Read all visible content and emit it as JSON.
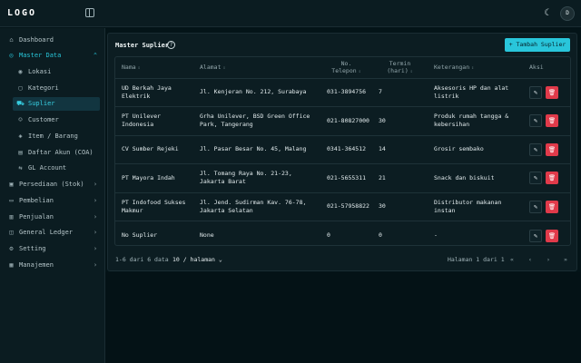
{
  "header": {
    "logo": "LOGO",
    "user_initial": "D"
  },
  "sidebar": {
    "items": [
      {
        "label": "Dashboard",
        "icon": "home-icon",
        "glyph": "⌂"
      },
      {
        "label": "Master Data",
        "icon": "database-icon",
        "glyph": "◎"
      },
      {
        "label": "Lokasi",
        "icon": "map-pin-icon",
        "glyph": "◉"
      },
      {
        "label": "Kategori",
        "icon": "category-icon",
        "glyph": "▢"
      },
      {
        "label": "Suplier",
        "icon": "truck-icon",
        "glyph": "⛟"
      },
      {
        "label": "Customer",
        "icon": "users-icon",
        "glyph": "☺"
      },
      {
        "label": "Item / Barang",
        "icon": "box-icon",
        "glyph": "◈"
      },
      {
        "label": "Daftar Akun (COA)",
        "icon": "book-icon",
        "glyph": "▤"
      },
      {
        "label": "GL Account",
        "icon": "swap-icon",
        "glyph": "⇆"
      },
      {
        "label": "Persediaan (Stok)",
        "icon": "archive-icon",
        "glyph": "▣"
      },
      {
        "label": "Pembelian",
        "icon": "cart-icon",
        "glyph": "▭"
      },
      {
        "label": "Penjualan",
        "icon": "receipt-icon",
        "glyph": "▥"
      },
      {
        "label": "General Ledger",
        "icon": "ledger-icon",
        "glyph": "◫"
      },
      {
        "label": "Setting",
        "icon": "gear-icon",
        "glyph": "⚙"
      },
      {
        "label": "Manajemen",
        "icon": "briefcase-icon",
        "glyph": "▦"
      }
    ]
  },
  "main": {
    "title": "Master Suplier",
    "add_button": "+ Tambah Suplier",
    "columns": {
      "nama": "Nama",
      "alamat": "Alamat",
      "telepon_1": "No.",
      "telepon_2": "Telepon",
      "termin_1": "Termin",
      "termin_2": "(hari)",
      "keterangan": "Keterangan",
      "aksi": "Aksi"
    },
    "rows": [
      {
        "nama": "UD Berkah Jaya Elektrik",
        "alamat": "Jl. Kenjeran No. 212, Surabaya",
        "telepon": "031-3894756",
        "termin": "7",
        "keterangan": "Aksesoris HP dan alat listrik"
      },
      {
        "nama": "PT Unilever Indonesia",
        "alamat": "Grha Unilever, BSD Green Office Park, Tangerang",
        "telepon": "021-80827000",
        "termin": "30",
        "keterangan": "Produk rumah tangga & kebersihan"
      },
      {
        "nama": "CV Sumber Rejeki",
        "alamat": "Jl. Pasar Besar No. 45, Malang",
        "telepon": "0341-364512",
        "termin": "14",
        "keterangan": "Grosir sembako"
      },
      {
        "nama": "PT Mayora Indah",
        "alamat": "Jl. Tomang Raya No. 21-23, Jakarta Barat",
        "telepon": "021-5655311",
        "termin": "21",
        "keterangan": "Snack dan biskuit"
      },
      {
        "nama": "PT Indofood Sukses Makmur",
        "alamat": "Jl. Jend. Sudirman Kav. 76-78, Jakarta Selatan",
        "telepon": "021-57958822",
        "termin": "30",
        "keterangan": "Distributor makanan instan"
      },
      {
        "nama": "No Suplier",
        "alamat": "None",
        "telepon": "0",
        "termin": "0",
        "keterangan": "-"
      }
    ],
    "footer": {
      "range": "1-6 dari 6 data",
      "page_size": "10 / halaman",
      "page_info": "Halaman 1 dari 1"
    }
  },
  "colors": {
    "accent": "#29c6db",
    "danger": "#e03a4a",
    "background": "#041418",
    "panel": "#0b1c21"
  }
}
